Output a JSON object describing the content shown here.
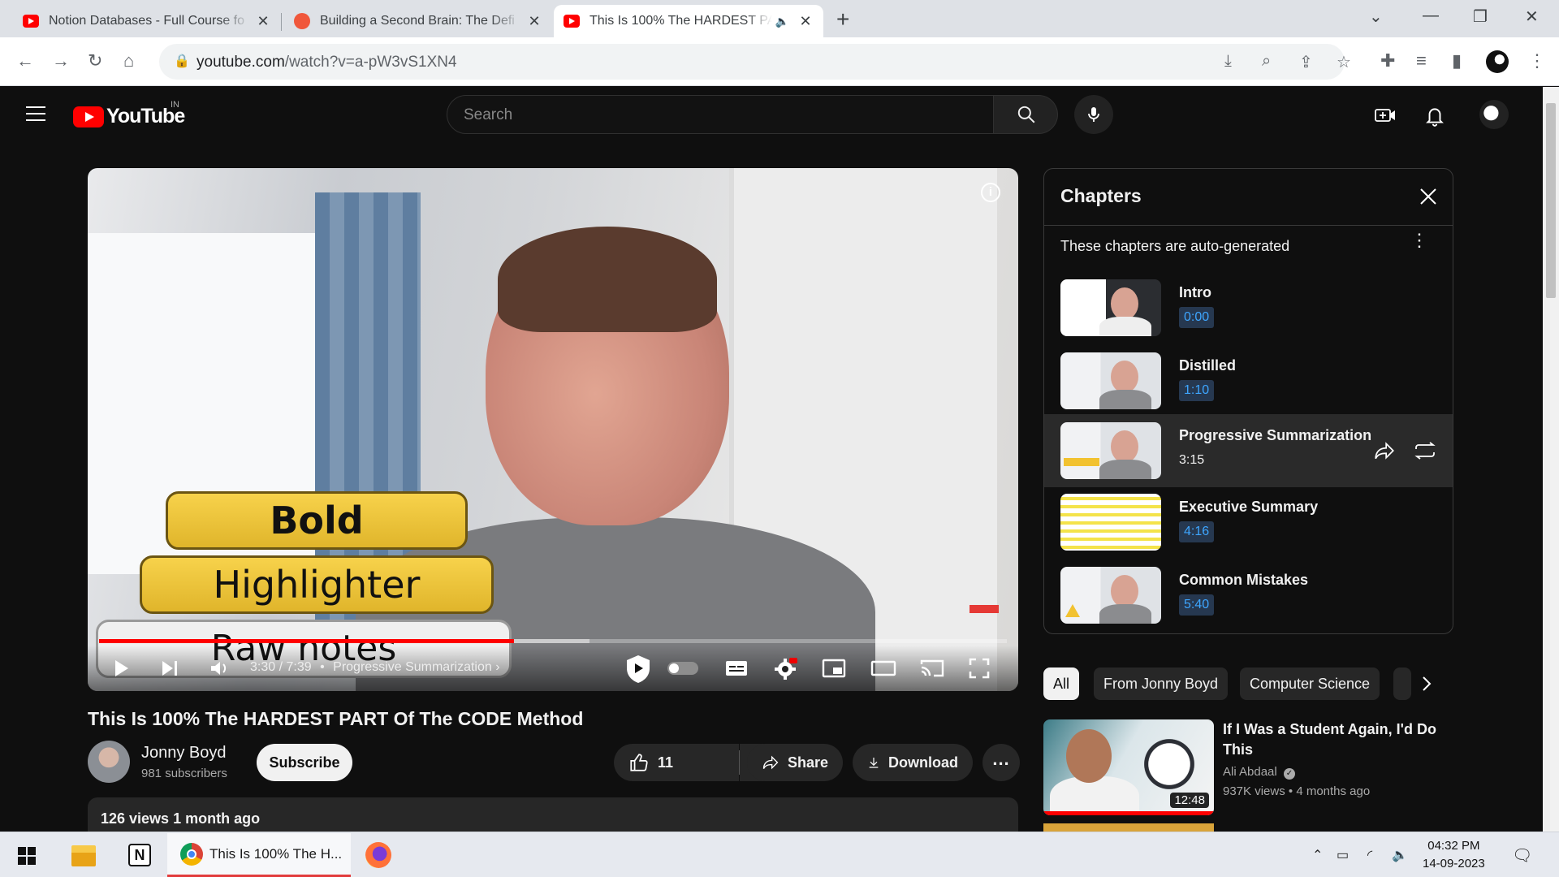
{
  "browser": {
    "tabs": [
      {
        "title": "Notion Databases - Full Course fo",
        "active": false,
        "favicon": "youtube-icon"
      },
      {
        "title": "Building a Second Brain: The Defi",
        "active": false,
        "favicon": "bsb-icon"
      },
      {
        "title": "This Is 100% The HARDEST PA",
        "active": true,
        "favicon": "youtube-icon"
      }
    ],
    "url_host": "youtube.com",
    "url_path": "/watch?v=a-pW3vS1XN4"
  },
  "youtube": {
    "logo_text": "YouTube",
    "country_code": "IN",
    "search_placeholder": "Search"
  },
  "video": {
    "title": "This Is 100% The HARDEST PART Of The CODE Method",
    "overlay": {
      "bold": "Bold",
      "highlighter": "Highlighter",
      "raw": "Raw notes"
    },
    "time": "3:30 / 7:39",
    "chapter_label": "Progressive Summarization",
    "progress": 0.457,
    "buffered": 0.54
  },
  "channel": {
    "name": "Jonny Boyd",
    "subscribers": "981 subscribers",
    "subscribe_label": "Subscribe"
  },
  "actions": {
    "likes": "11",
    "share": "Share",
    "download": "Download"
  },
  "description": {
    "meta": "126 views  1 month ago"
  },
  "chapters_panel": {
    "title": "Chapters",
    "note": "These chapters are auto-generated",
    "items": [
      {
        "name": "Intro",
        "time": "0:00",
        "current": false
      },
      {
        "name": "Distilled",
        "time": "1:10",
        "current": false
      },
      {
        "name": "Progressive Summarization",
        "time": "3:15",
        "current": true
      },
      {
        "name": "Executive Summary",
        "time": "4:16",
        "current": false
      },
      {
        "name": "Common Mistakes",
        "time": "5:40",
        "current": false
      }
    ]
  },
  "chips": [
    "All",
    "From Jonny Boyd",
    "Computer Science"
  ],
  "recommendation": {
    "title": "If I Was a Student Again, I'd Do This",
    "channel": "Ali Abdaal",
    "views": "937K views",
    "age": "4 months ago",
    "duration": "12:48"
  },
  "taskbar": {
    "chrome_label": "This Is 100% The H...",
    "time": "04:32 PM",
    "date": "14-09-2023"
  },
  "colors": {
    "youtube_red": "#ff0000",
    "accent_blue": "#3ea6ff",
    "background": "#0f0f0f"
  }
}
